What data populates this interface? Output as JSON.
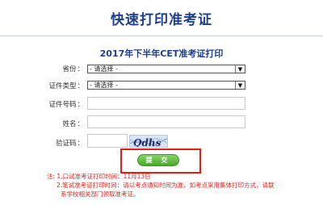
{
  "header": {
    "title": "快速打印准考证"
  },
  "form": {
    "title": "2017年下半年CET准考证打印",
    "province": {
      "label": "省份",
      "value": "- 请选择 -"
    },
    "id_type": {
      "label": "证件类型",
      "value": "- 请选择 -"
    },
    "id_number": {
      "label": "证件号码",
      "value": ""
    },
    "name": {
      "label": "姓名",
      "value": ""
    },
    "captcha": {
      "label": "验证码",
      "value": "",
      "image_text": "Qdhs"
    },
    "colon": "：",
    "submit_label": "提 交"
  },
  "notes": {
    "line1": "注: 1.口试准考证打印时间：11月13日",
    "line2": "2.笔试准考证打印时间：请以考点通知时间为准，如考点采用集体打印方式，请联",
    "line3": "系学校相关部门领取准考证。"
  },
  "colors": {
    "title_blue": "#1d3f8f",
    "note_red": "#e0241c",
    "button_green": "#4aa82b",
    "highlight_red": "#e41b17"
  }
}
